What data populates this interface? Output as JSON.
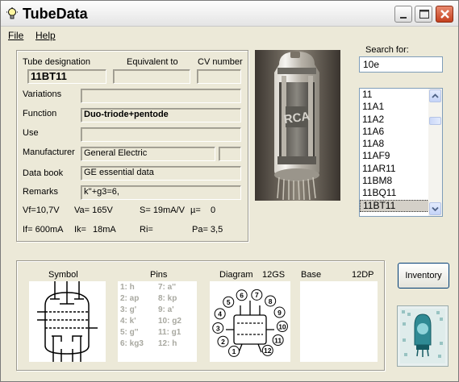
{
  "window": {
    "title": "TubeData"
  },
  "menu": [
    {
      "label": "File"
    },
    {
      "label": "Help"
    }
  ],
  "details": {
    "tube_designation_label": "Tube designation",
    "equivalent_label": "Equivalent to",
    "cv_label": "CV number",
    "tube_designation_value": "11BT11",
    "equivalent_value": "",
    "cv_value": "",
    "variations_label": "Variations",
    "variations_value": "",
    "function_label": "Function",
    "function_value": "Duo-triode+pentode",
    "use_label": "Use",
    "use_value": "",
    "manufacturer_label": "Manufacturer",
    "manufacturer_value": "General Electric",
    "manufacturer_code": "",
    "databook_label": "Data book",
    "databook_value": "GE essential data",
    "remarks_label": "Remarks",
    "remarks_value": "k''+g3=6,"
  },
  "params": {
    "vf": "Vf=10,7V",
    "va": "Va= 165V",
    "s": "S= 19mA/V",
    "mu": "µ=",
    "mu_val": "0",
    "if": "If= 600mA",
    "ik": "Ik=",
    "ik_val": "18mA",
    "ri": "Ri=",
    "pa": "Pa= 3,5"
  },
  "search": {
    "label": "Search for:",
    "value": "10e"
  },
  "tube_list": {
    "items": [
      "11",
      "11A1",
      "11A2",
      "11A6",
      "11A8",
      "11AF9",
      "11AR11",
      "11BM8",
      "11BQ11",
      "11BT11"
    ],
    "selected": "11BT11"
  },
  "bottom": {
    "symbol_label": "Symbol",
    "pins_label": "Pins",
    "diagram_label": "Diagram",
    "diagram_code": "12GS",
    "base_label": "Base",
    "base_code": "12DP",
    "pins_left": [
      "1: h",
      "2: ap",
      "3: g'",
      "4: k'",
      "5: g''",
      "6: kg3"
    ],
    "pins_right": [
      "7: a''",
      "8: kp",
      "9: a'",
      "10: g2",
      "11: g1",
      "12: h"
    ],
    "diagram_numbers": [
      "1",
      "2",
      "3",
      "4",
      "5",
      "6",
      "7",
      "8",
      "9",
      "10",
      "11",
      "12"
    ]
  },
  "buttons": {
    "inventory": "Inventory"
  },
  "photo": {
    "brand": "RCA"
  },
  "colors": {
    "bg": "#ece9d8",
    "list_sel": "#d4d0c8",
    "close": "#c4401f"
  }
}
